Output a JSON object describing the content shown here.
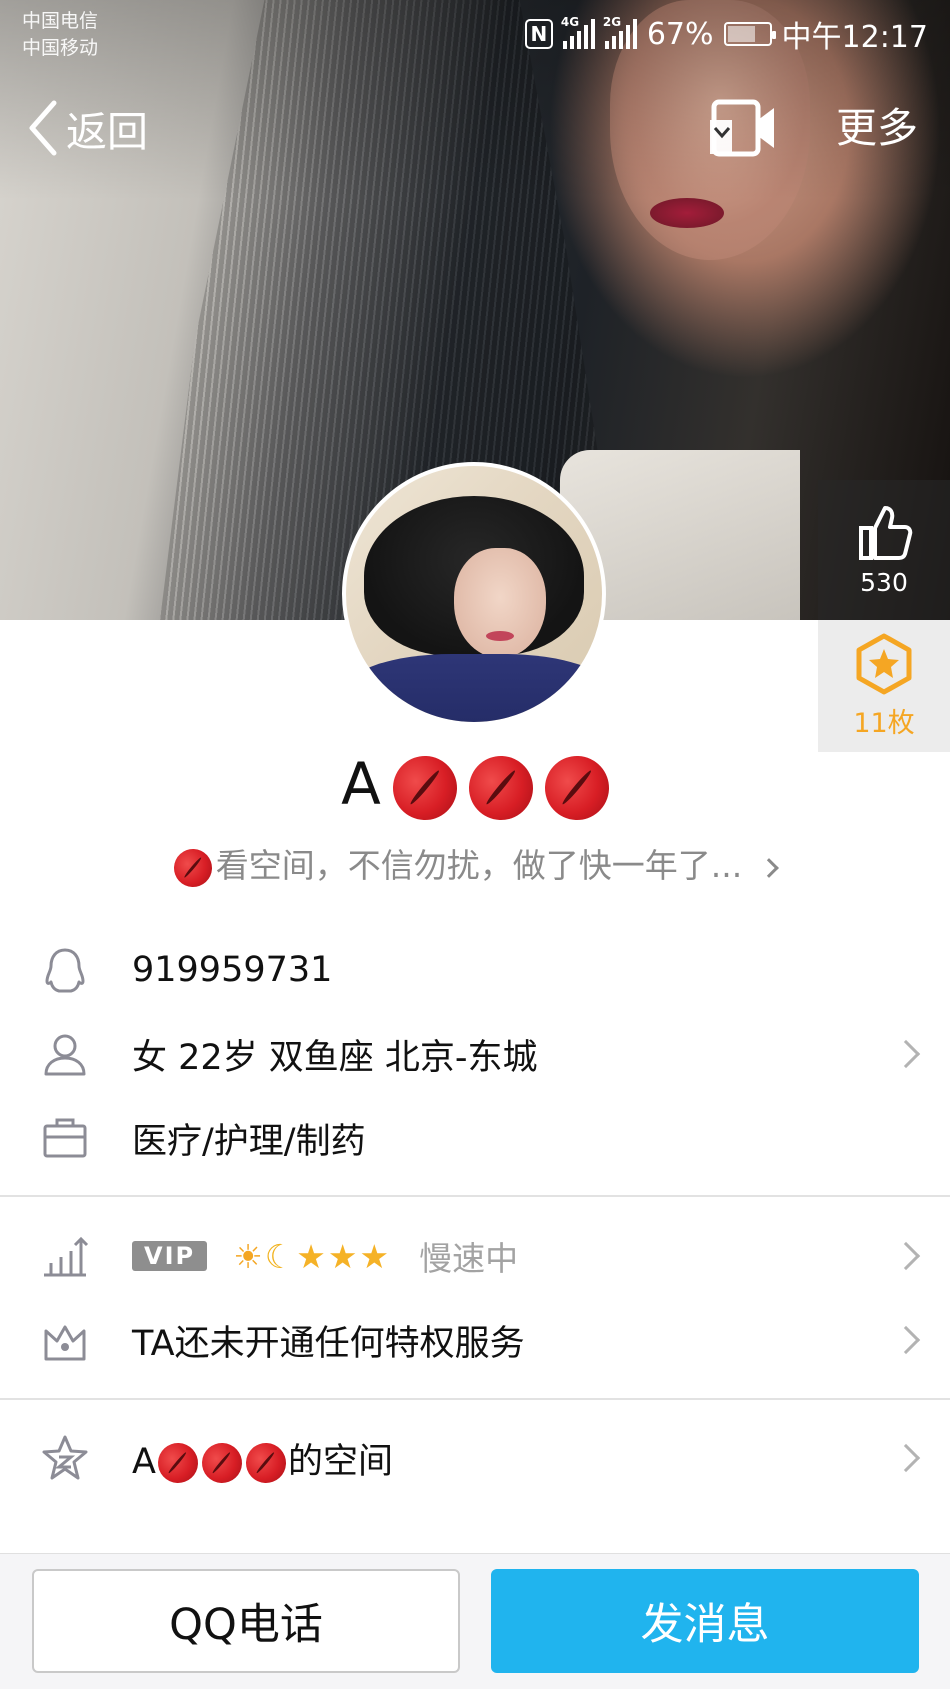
{
  "status_bar": {
    "carrier_1": "中国电信",
    "carrier_2": "中国移动",
    "net_1": "4G",
    "net_2": "2G",
    "battery": "67%",
    "time": "中午12:17"
  },
  "nav": {
    "back_label": "返回",
    "more_label": "更多"
  },
  "side": {
    "like_count": "530",
    "medal_count": "11枚"
  },
  "profile": {
    "name_prefix": "A",
    "signature": "看空间，不信勿扰，做了快一年了..."
  },
  "info": {
    "qq_number": "919959731",
    "personal": "女  22岁  双鱼座  北京-东城",
    "occupation": "医疗/护理/制药"
  },
  "level": {
    "vip_label": "VIP",
    "status": "慢速中"
  },
  "privilege": {
    "text": "TA还未开通任何特权服务"
  },
  "zone": {
    "prefix": "A",
    "suffix": "的空间"
  },
  "buttons": {
    "call": "QQ电话",
    "message": "发消息"
  },
  "colors": {
    "accent_blue": "#20b4ee",
    "medal_orange": "#f5a623",
    "vip_gray": "#8e8e8e"
  },
  "icons": [
    "back-arrow-icon",
    "video-call-icon",
    "thumbs-up-icon",
    "medal-star-icon",
    "penguin-icon",
    "person-icon",
    "briefcase-icon",
    "level-chart-icon",
    "crown-icon",
    "qzone-star-icon",
    "lips-emoji-icon"
  ]
}
